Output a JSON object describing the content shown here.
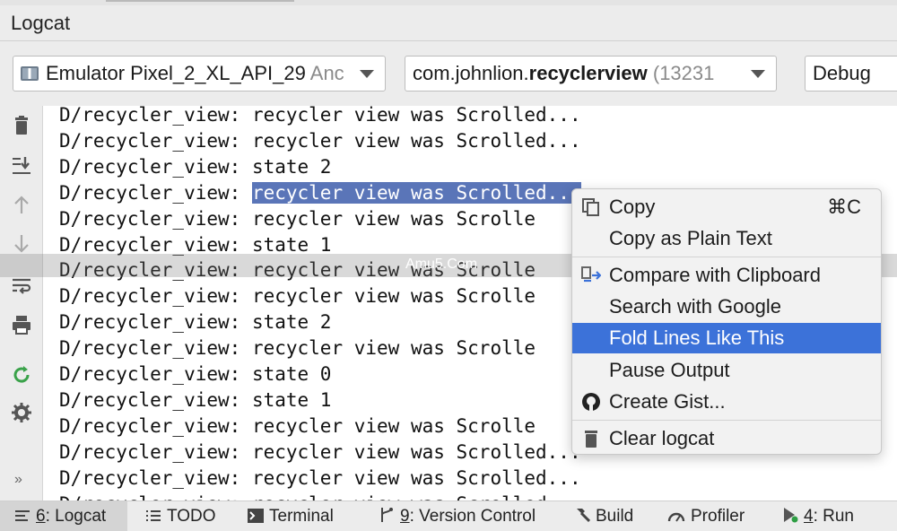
{
  "window": {
    "title": "Logcat"
  },
  "toolbar": {
    "device": {
      "name": "Emulator Pixel_2_XL_API_29",
      "suffix": "Anc"
    },
    "process": {
      "prefix": "com.johnlion.",
      "bold": "recyclerview",
      "pid": "(13231"
    },
    "level": "Debug"
  },
  "left_toolbar": [
    {
      "icon": "trash-icon"
    },
    {
      "icon": "scroll-to-end-icon"
    },
    {
      "icon": "arrow-up-icon"
    },
    {
      "icon": "arrow-down-icon"
    },
    {
      "icon": "soft-wrap-icon"
    },
    {
      "icon": "print-icon"
    },
    {
      "icon": "restart-icon"
    },
    {
      "icon": "gear-icon"
    },
    {
      "icon": "chevrons-right-icon",
      "glyph": "»"
    }
  ],
  "log": {
    "lines": [
      {
        "tag": "D/recycler_view: ",
        "msg": "recycler view was Scrolled..."
      },
      {
        "tag": "D/recycler_view: ",
        "msg": "recycler view was Scrolled..."
      },
      {
        "tag": "D/recycler_view: ",
        "msg": "state 2"
      },
      {
        "tag": "D/recycler_view: ",
        "msg": "recycler view was Scrolled..."
      },
      {
        "tag": "D/recycler_view: ",
        "msg": "recycler view was Scrolle"
      },
      {
        "tag": "D/recycler_view: ",
        "msg": "state 1"
      },
      {
        "tag": "D/recycler_view: ",
        "msg": "recycler view was Scrolle"
      },
      {
        "tag": "D/recycler_view: ",
        "msg": "recycler view was Scrolle"
      },
      {
        "tag": "D/recycler_view: ",
        "msg": "state 2"
      },
      {
        "tag": "D/recycler_view: ",
        "msg": "recycler view was Scrolle"
      },
      {
        "tag": "D/recycler_view: ",
        "msg": "state 0"
      },
      {
        "tag": "D/recycler_view: ",
        "msg": "state 1"
      },
      {
        "tag": "D/recycler_view: ",
        "msg": "recycler view was Scrolle"
      },
      {
        "tag": "D/recycler_view: ",
        "msg": "recycler view was Scrolled..."
      },
      {
        "tag": "D/recycler_view: ",
        "msg": "recycler view was Scrolled..."
      },
      {
        "tag": "D/recycler_view: ",
        "msg": "recycler view was Scrolled..."
      }
    ],
    "selected_index": 3
  },
  "watermark": "Amu5.Com",
  "context_menu": {
    "copy": {
      "label": "Copy",
      "shortcut": "⌘C",
      "icon": "copy-icon"
    },
    "copy_plain": {
      "label": "Copy as Plain Text"
    },
    "compare": {
      "label": "Compare with Clipboard",
      "icon": "compare-icon"
    },
    "search_google": {
      "label": "Search with Google"
    },
    "fold_lines": {
      "label": "Fold Lines Like This",
      "highlighted": true
    },
    "pause_output": {
      "label": "Pause Output"
    },
    "create_gist": {
      "label": "Create Gist...",
      "icon": "github-icon"
    },
    "clear_logcat": {
      "label": "Clear logcat",
      "icon": "trash-icon"
    }
  },
  "status_bar": {
    "logcat": {
      "key": "6",
      "rest": ": Logcat",
      "active": true,
      "icon": "logcat-icon"
    },
    "todo": {
      "label": "TODO",
      "icon": "list-icon"
    },
    "terminal": {
      "label": "Terminal",
      "icon": "terminal-icon"
    },
    "vcs": {
      "key": "9",
      "rest": ": Version Control",
      "icon": "branch-icon"
    },
    "build": {
      "label": "Build",
      "icon": "hammer-icon"
    },
    "profiler": {
      "label": "Profiler",
      "icon": "gauge-icon"
    },
    "run": {
      "key": "4",
      "rest": ": Run",
      "icon": "play-icon"
    }
  },
  "colors": {
    "selection": "#5a75b8",
    "menu_highlight": "#3c72d9",
    "run_icon": "#2e9e44",
    "restart_icon": "#3aa24a"
  }
}
